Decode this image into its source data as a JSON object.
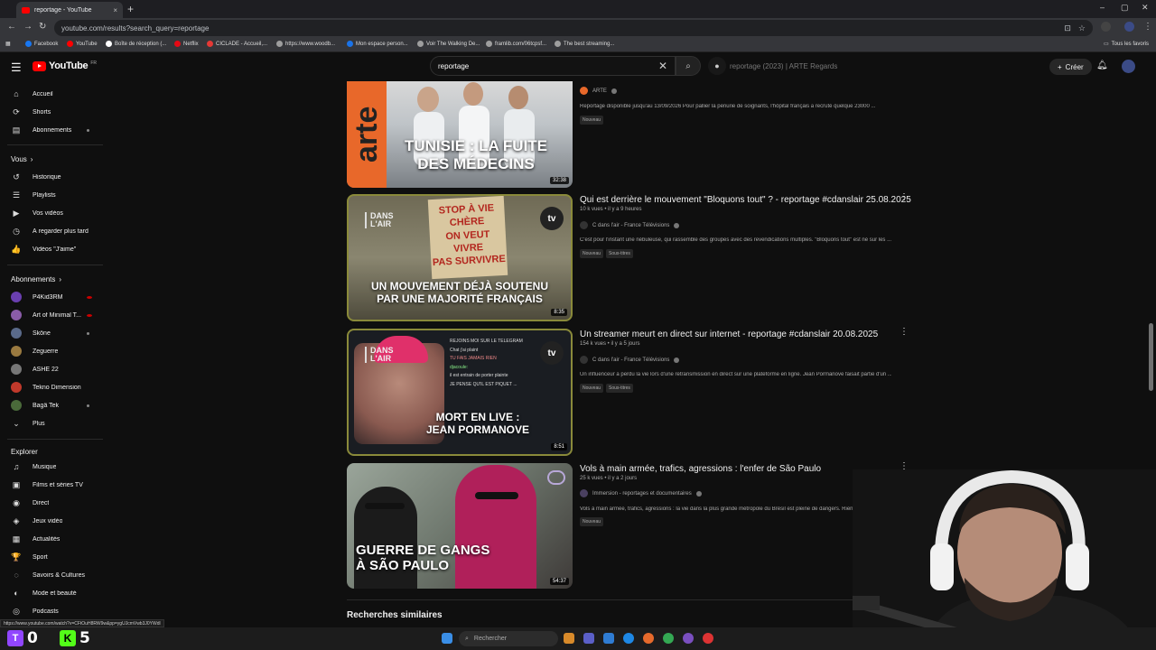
{
  "browser": {
    "tab_title": "reportage - YouTube",
    "tab_close": "×",
    "new_tab": "+",
    "url": "youtube.com/results?search_query=reportage",
    "window_controls": [
      "–",
      "▢",
      "✕"
    ],
    "bookmarks": [
      {
        "label": "Facebook",
        "color": "#1877f2"
      },
      {
        "label": "YouTube",
        "color": "#ff0000"
      },
      {
        "label": "Boîte de réception (...",
        "color": "#ffffff"
      },
      {
        "label": "Netflix",
        "color": "#e50914"
      },
      {
        "label": "CICLADE - Accueil,...",
        "color": "#e53935"
      },
      {
        "label": "https://www.woodb...",
        "color": "#9e9e9e"
      },
      {
        "label": "Mon espace person...",
        "color": "#1a73e8"
      },
      {
        "label": "Voir The Walking De...",
        "color": "#9e9e9e"
      },
      {
        "label": "framlib.com/06tcpsf...",
        "color": "#9e9e9e"
      },
      {
        "label": "The best streaming...",
        "color": "#9e9e9e"
      }
    ],
    "all_bookmarks": "Tous les favoris"
  },
  "header": {
    "logo_text": "YouTube",
    "logo_country": "FR",
    "search_value": "reportage",
    "search_clear": "✕",
    "ghost_title": "reportage (2023) | ARTE Regards",
    "create_label": "Créer",
    "create_plus": "+"
  },
  "sidebar": {
    "main": [
      {
        "label": "Accueil",
        "icon": "⌂"
      },
      {
        "label": "Shorts",
        "icon": "⟳"
      },
      {
        "label": "Abonnements",
        "icon": "▤"
      }
    ],
    "you_heading": "Vous",
    "you": [
      {
        "label": "Historique",
        "icon": "↺"
      },
      {
        "label": "Playlists",
        "icon": "☰"
      },
      {
        "label": "Vos vidéos",
        "icon": "▶"
      },
      {
        "label": "À regarder plus tard",
        "icon": "◷"
      },
      {
        "label": "Vidéos \"J'aime\"",
        "icon": "👍"
      }
    ],
    "subs_heading": "Abonnements",
    "subs": [
      {
        "label": "P4Kid3RM",
        "color": "#6a3fb0",
        "indicator": "live"
      },
      {
        "label": "Art of Minimal T...",
        "color": "#8a5ca8",
        "indicator": "live"
      },
      {
        "label": "Skône",
        "color": "#5a6a8a",
        "indicator": "dot"
      },
      {
        "label": "Zeguerre",
        "color": "#9a7a40",
        "indicator": ""
      },
      {
        "label": "ASHE 22",
        "color": "#777777",
        "indicator": ""
      },
      {
        "label": "Tekno Dimension",
        "color": "#c0392b",
        "indicator": ""
      },
      {
        "label": "Bagâ Tek",
        "color": "#4a6a3a",
        "indicator": "dot"
      }
    ],
    "more_label": "Plus",
    "explore_heading": "Explorer",
    "explore": [
      {
        "label": "Musique",
        "icon": "♫"
      },
      {
        "label": "Films et séries TV",
        "icon": "▣"
      },
      {
        "label": "Direct",
        "icon": "◉"
      },
      {
        "label": "Jeux vidéo",
        "icon": "◈"
      },
      {
        "label": "Actualités",
        "icon": "▦"
      },
      {
        "label": "Sport",
        "icon": "🏆"
      },
      {
        "label": "Savoirs & Cultures",
        "icon": "◌"
      },
      {
        "label": "Mode et beauté",
        "icon": "◐"
      },
      {
        "label": "Podcasts",
        "icon": "◎"
      }
    ]
  },
  "results": [
    {
      "title": "",
      "meta": "",
      "channel": "ARTE",
      "verified": true,
      "description": "Reportage disponible jusqu'au 13/09/2026 Pour pallier la pénurie de soignants, l'hôpital français a recruté quelque 23000 ...",
      "badges": [
        "Nouveau"
      ],
      "duration": "32:38",
      "overlay": "TUNISIE : LA FUITE\nDES MÉDECINS",
      "thumb_brand": "arte"
    },
    {
      "title": "Qui est derrière le mouvement \"Bloquons tout\" ? - reportage #cdanslair 25.08.2025",
      "meta": "10 k vues • il y a 9 heures",
      "channel": "C dans l'air - France Télévisions",
      "verified": true,
      "description": "C'est pour l'instant une nébuleuse, qui rassemble des groupes avec des revendications multiples. \"Bloquons tout\" est né sur les ...",
      "badges": [
        "Nouveau",
        "Sous-titres"
      ],
      "duration": "8:35",
      "overlay": "UN MOUVEMENT DÉJÀ SOUTENU\nPAR UNE MAJORITÉ FRANÇAIS",
      "sign_text": "STOP À VIE CHÈRE\nON VEUT VIVRE\nPAS SURVIVRE",
      "show_logo": "DANS\nL'AIR",
      "tv_logo": "tv"
    },
    {
      "title": "Un streamer meurt en direct sur internet - reportage #cdanslair 20.08.2025",
      "meta": "154 k vues • il y a 5 jours",
      "channel": "C dans l'air - France Télévisions",
      "verified": true,
      "description": "Un influenceur a perdu la vie lors d'une retransmission en direct sur une plateforme en ligne. Jean Pormanove faisait partie d'un ...",
      "badges": [
        "Nouveau",
        "Sous-titres"
      ],
      "duration": "8:51",
      "overlay": "MORT EN LIVE :\nJEAN PORMANOVE",
      "chat_lines": [
        "REJOINS MOI SUR LE TELEGRAM",
        "Chat j'ai plaint",
        "TU FAIS JAMAIS RIEN",
        "djacoule:",
        "il est entrain de porter plainte",
        "JE PENSE QU'IL EST PIQUET ..."
      ],
      "show_logo": "DANS\nL'AIR",
      "tv_logo": "tv"
    },
    {
      "title": "Vols à main armée, trafics, agressions : l'enfer de São Paulo",
      "meta": "25 k vues • il y a 2 jours",
      "channel": "Immersion - reportages et documentaires",
      "verified": true,
      "description": "Vols à main armée, trafics, agressions : la vie dans la plus grande métropole du Brésil est pleine de dangers. Rien que l'année ...",
      "badges": [
        "Nouveau"
      ],
      "duration": "54:37",
      "overlay": "GUERRE DE GANGS\nÀ SÃO PAULO"
    }
  ],
  "related_heading": "Recherches similaires",
  "status_url": "https://www.youtube.com/watch?v=CFtOuH8RW9w&pp=ygUJcmVwb3J0YWdl",
  "taskbar": {
    "search_label": "Rechercher"
  },
  "overlay_counters": [
    {
      "value": "0",
      "color": "#9146ff",
      "glyph": "T"
    },
    {
      "value": "5",
      "color": "#53fc18",
      "glyph": "K"
    }
  ]
}
